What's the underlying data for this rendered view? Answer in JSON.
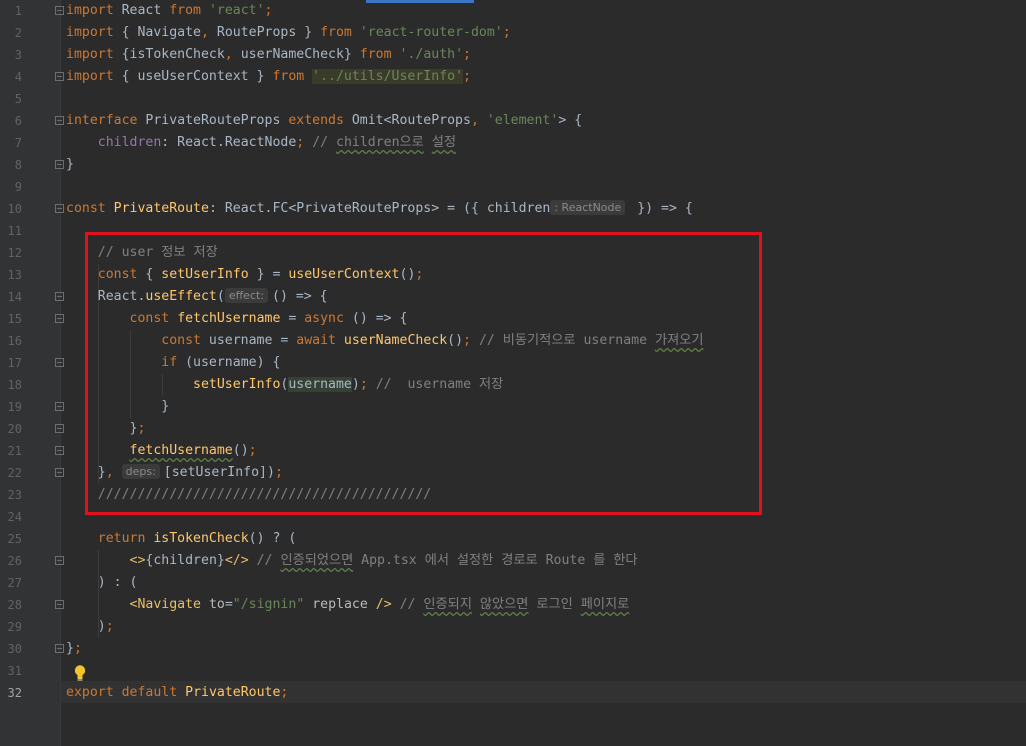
{
  "editor": {
    "line_numbers": [
      "1",
      "2",
      "3",
      "4",
      "5",
      "6",
      "7",
      "8",
      "9",
      "10",
      "11",
      "12",
      "13",
      "14",
      "15",
      "16",
      "17",
      "18",
      "19",
      "20",
      "21",
      "22",
      "23",
      "24",
      "25",
      "26",
      "27",
      "28",
      "29",
      "30",
      "31",
      "32"
    ],
    "current_line": "32",
    "lines": [
      [
        [
          "kw",
          "import"
        ],
        [
          "t",
          " React "
        ],
        [
          "kw",
          "from"
        ],
        [
          "t",
          " "
        ],
        [
          "str",
          "'react'"
        ],
        [
          "kw",
          ";"
        ]
      ],
      [
        [
          "kw",
          "import"
        ],
        [
          "t",
          " { Navigate"
        ],
        [
          "kw",
          ","
        ],
        [
          "t",
          " RouteProps } "
        ],
        [
          "kw",
          "from"
        ],
        [
          "t",
          " "
        ],
        [
          "str",
          "'react-router-dom'"
        ],
        [
          "kw",
          ";"
        ]
      ],
      [
        [
          "kw",
          "import"
        ],
        [
          "t",
          " {isTokenCheck"
        ],
        [
          "kw",
          ","
        ],
        [
          "t",
          " userNameCheck} "
        ],
        [
          "kw",
          "from"
        ],
        [
          "t",
          " "
        ],
        [
          "str",
          "'./auth'"
        ],
        [
          "kw",
          ";"
        ]
      ],
      [
        [
          "kw",
          "import"
        ],
        [
          "t",
          " { useUserContext } "
        ],
        [
          "kw",
          "from"
        ],
        [
          "t",
          " "
        ],
        [
          "strhl",
          "'../utils/UserInfo'"
        ],
        [
          "kw",
          ";"
        ]
      ],
      [],
      [
        [
          "kw",
          "interface"
        ],
        [
          "t",
          " PrivateRouteProps "
        ],
        [
          "kw",
          "extends"
        ],
        [
          "t",
          " Omit<RouteProps"
        ],
        [
          "kw",
          ","
        ],
        [
          "t",
          " "
        ],
        [
          "str",
          "'element'"
        ],
        [
          "t",
          "> {"
        ]
      ],
      [
        [
          "t",
          "    "
        ],
        [
          "prop",
          "children"
        ],
        [
          "t",
          ": React.ReactNode"
        ],
        [
          "kw",
          ";"
        ],
        [
          "t",
          " "
        ],
        [
          "cm",
          "// "
        ],
        [
          "cmw",
          "children으로"
        ],
        [
          "cm",
          " "
        ],
        [
          "cmw",
          "설정"
        ]
      ],
      [
        [
          "t",
          "}"
        ]
      ],
      [],
      [
        [
          "kw",
          "const"
        ],
        [
          "t",
          " "
        ],
        [
          "fn",
          "PrivateRoute"
        ],
        [
          "t",
          ": React.FC<PrivateRouteProps> = ({ children"
        ],
        [
          "hint",
          ": ReactNode"
        ],
        [
          "t",
          " }) => {"
        ]
      ],
      [],
      [
        [
          "t",
          "    "
        ],
        [
          "cm",
          "// user 정보 저장"
        ]
      ],
      [
        [
          "t",
          "    "
        ],
        [
          "kw",
          "const"
        ],
        [
          "t",
          " { "
        ],
        [
          "fn",
          "setUserInfo"
        ],
        [
          "t",
          " } = "
        ],
        [
          "fn",
          "useUserContext"
        ],
        [
          "t",
          "()"
        ],
        [
          "kw",
          ";"
        ]
      ],
      [
        [
          "t",
          "    React."
        ],
        [
          "fn",
          "useEffect"
        ],
        [
          "t",
          "("
        ],
        [
          "hint",
          "effect:"
        ],
        [
          "t",
          "() => {"
        ]
      ],
      [
        [
          "t",
          "        "
        ],
        [
          "kw",
          "const"
        ],
        [
          "t",
          " "
        ],
        [
          "fn",
          "fetchUsername"
        ],
        [
          "t",
          " = "
        ],
        [
          "kw",
          "async"
        ],
        [
          "t",
          " () => {"
        ]
      ],
      [
        [
          "t",
          "            "
        ],
        [
          "kw",
          "const"
        ],
        [
          "t",
          " username = "
        ],
        [
          "kw",
          "await"
        ],
        [
          "t",
          " "
        ],
        [
          "fn",
          "userNameCheck"
        ],
        [
          "t",
          "()"
        ],
        [
          "kw",
          ";"
        ],
        [
          "t",
          " "
        ],
        [
          "cm",
          "// 비동기적으로 username "
        ],
        [
          "cmw",
          "가져오기"
        ]
      ],
      [
        [
          "t",
          "            "
        ],
        [
          "kw",
          "if"
        ],
        [
          "t",
          " (username) {"
        ]
      ],
      [
        [
          "t",
          "                "
        ],
        [
          "fn",
          "setUserInfo"
        ],
        [
          "t",
          "("
        ],
        [
          "varhl",
          "username"
        ],
        [
          "t",
          ")"
        ],
        [
          "kw",
          ";"
        ],
        [
          "t",
          " "
        ],
        [
          "cm",
          "//  username 저장"
        ]
      ],
      [
        [
          "t",
          "            }"
        ]
      ],
      [
        [
          "t",
          "        }"
        ],
        [
          "kw",
          ";"
        ]
      ],
      [
        [
          "t",
          "        "
        ],
        [
          "fnw",
          "fetchUsername"
        ],
        [
          "t",
          "()"
        ],
        [
          "kw",
          ";"
        ]
      ],
      [
        [
          "t",
          "    }"
        ],
        [
          "kw",
          ","
        ],
        [
          "t",
          " "
        ],
        [
          "hint",
          "deps:"
        ],
        [
          "t",
          "[setUserInfo])"
        ],
        [
          "kw",
          ";"
        ]
      ],
      [
        [
          "t",
          "    "
        ],
        [
          "cm",
          "//////////////////////////////////////////"
        ]
      ],
      [],
      [
        [
          "t",
          "    "
        ],
        [
          "kw",
          "return"
        ],
        [
          "t",
          " "
        ],
        [
          "fn",
          "isTokenCheck"
        ],
        [
          "t",
          "() ? ("
        ]
      ],
      [
        [
          "t",
          "        "
        ],
        [
          "tag",
          "<>"
        ],
        [
          "t",
          "{children}"
        ],
        [
          "tag",
          "</>"
        ],
        [
          "t",
          " "
        ],
        [
          "cm",
          "// "
        ],
        [
          "cmw",
          "인증되었으면"
        ],
        [
          "cm",
          " App.tsx 에서 설정한 경로로 Route 를 한다"
        ]
      ],
      [
        [
          "t",
          "    ) : ("
        ]
      ],
      [
        [
          "t",
          "        "
        ],
        [
          "tag",
          "<Navigate"
        ],
        [
          "t",
          " "
        ],
        [
          "attr",
          "to"
        ],
        [
          "t",
          "="
        ],
        [
          "str",
          "\"/signin\""
        ],
        [
          "t",
          " "
        ],
        [
          "attr",
          "replace"
        ],
        [
          "t",
          " "
        ],
        [
          "tag",
          "/>"
        ],
        [
          "t",
          " "
        ],
        [
          "cm",
          "// "
        ],
        [
          "cmw",
          "인증되지"
        ],
        [
          "cm",
          " "
        ],
        [
          "cmw",
          "않았으면"
        ],
        [
          "cm",
          " 로그인 "
        ],
        [
          "cmw",
          "페이지로"
        ]
      ],
      [
        [
          "t",
          "    )"
        ],
        [
          "kw",
          ";"
        ]
      ],
      [
        [
          "t",
          "}"
        ],
        [
          "kw",
          ";"
        ]
      ],
      [],
      [
        [
          "kw",
          "export"
        ],
        [
          "t",
          " "
        ],
        [
          "kw",
          "default"
        ],
        [
          "t",
          " "
        ],
        [
          "fn",
          "PrivateRoute"
        ],
        [
          "kw",
          ";"
        ]
      ]
    ],
    "colors": {
      "keyword": "#cc7832",
      "string": "#6a8759",
      "function": "#ffc66d",
      "property": "#9876aa",
      "comment": "#808080",
      "highlight_box": "#e0101f"
    }
  }
}
